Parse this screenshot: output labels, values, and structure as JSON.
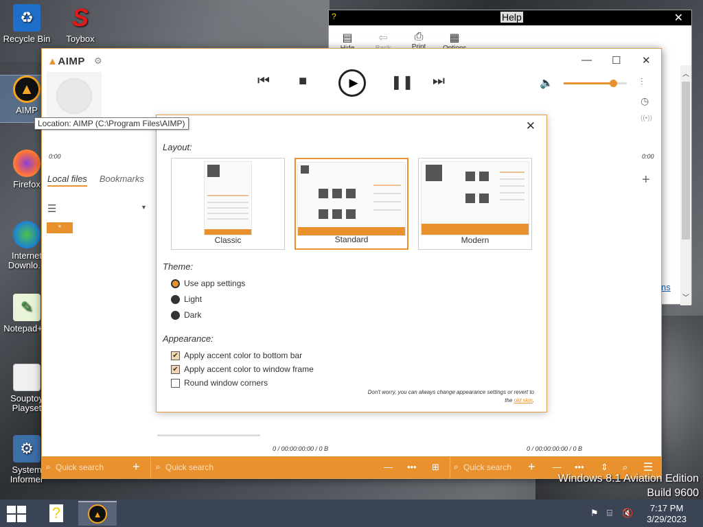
{
  "desktop": {
    "icons": [
      {
        "label": "Recycle Bin",
        "icon": "recycle-bin-icon"
      },
      {
        "label": "Toybox",
        "icon": "toybox-icon"
      },
      {
        "label": "AIMP",
        "icon": "aimp-icon"
      },
      {
        "label": "Firefox",
        "icon": "firefox-icon"
      },
      {
        "label": "Internet Downlo...",
        "icon": "idm-icon"
      },
      {
        "label": "Notepad+...",
        "icon": "notepad-icon"
      },
      {
        "label": "Souptoy Playset",
        "icon": "file-icon"
      },
      {
        "label": "System Informer",
        "icon": "system-informer-icon"
      }
    ],
    "watermark_line1": "Windows 8.1 Aviation Edition",
    "watermark_line2": "Build 9600"
  },
  "help_window": {
    "title": "Help",
    "close": "✕",
    "toolbar": [
      "Hide",
      "Back",
      "Print",
      "Options"
    ],
    "link_fragment": "ns"
  },
  "tooltip": "Location: AIMP (C:\\Program Files\\AIMP)",
  "aimp": {
    "logo": "AIMP",
    "time_left": "0:00",
    "time_right": "0:00",
    "volume_level": 0.78,
    "tabs": [
      {
        "label": "Local files",
        "active": true
      },
      {
        "label": "Bookmarks",
        "active": false
      }
    ],
    "playlist_tag": "*",
    "stats_left": "0 / 00:00:00:00 / 0 B",
    "stats_right": "0 / 00:00:00:00 / 0 B",
    "search_placeholder": "Quick search"
  },
  "dialog": {
    "layout_title": "Layout:",
    "layouts": [
      {
        "label": "Classic",
        "selected": false
      },
      {
        "label": "Standard",
        "selected": true
      },
      {
        "label": "Modern",
        "selected": false
      }
    ],
    "theme_title": "Theme:",
    "themes": [
      {
        "label": "Use app settings",
        "selected": true
      },
      {
        "label": "Light",
        "selected": false
      },
      {
        "label": "Dark",
        "selected": false
      }
    ],
    "appearance_title": "Appearance:",
    "appearance": [
      {
        "label": "Apply accent color to bottom bar",
        "checked": true
      },
      {
        "label": "Apply accent color to window frame",
        "checked": true
      },
      {
        "label": "Round window corners",
        "checked": false
      }
    ],
    "note_line1": "Don't worry, you can always change appearance settings or revert to",
    "note_line2_prefix": "the ",
    "note_link": "old skin",
    "note_suffix": "."
  },
  "taskbar": {
    "time": "7:17 PM",
    "date": "3/29/2023"
  },
  "colors": {
    "accent": "#e8912d",
    "taskbar": "#3a4454"
  }
}
